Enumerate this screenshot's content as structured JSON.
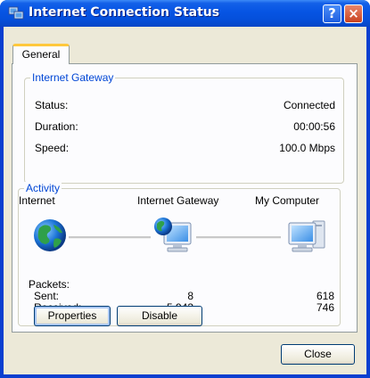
{
  "window": {
    "title": "Internet Connection Status",
    "help_glyph": "?",
    "close_glyph": "×"
  },
  "tabs": [
    {
      "label": "General"
    }
  ],
  "gateway": {
    "legend": "Internet Gateway",
    "rows": [
      {
        "label": "Status:",
        "value": "Connected"
      },
      {
        "label": "Duration:",
        "value": "00:00:56"
      },
      {
        "label": "Speed:",
        "value": "100.0 Mbps"
      }
    ]
  },
  "activity": {
    "legend": "Activity",
    "nodes": {
      "internet": "Internet",
      "gateway": "Internet Gateway",
      "computer": "My Computer"
    },
    "packets_label": "Packets:",
    "sent_label": "Sent:",
    "received_label": "Received:",
    "sent": {
      "gateway": "8",
      "computer": "618"
    },
    "received": {
      "gateway": "5,943",
      "computer": "746"
    },
    "icons": [
      "globe-icon",
      "gateway-computer-icon",
      "my-computer-icon"
    ]
  },
  "buttons": {
    "properties": "Properties",
    "disable": "Disable",
    "close": "Close"
  },
  "colors": {
    "titlebar": "#0654e3",
    "client": "#ece9d8",
    "legend": "#0046d5",
    "tab_highlight": "#ffc83c"
  }
}
